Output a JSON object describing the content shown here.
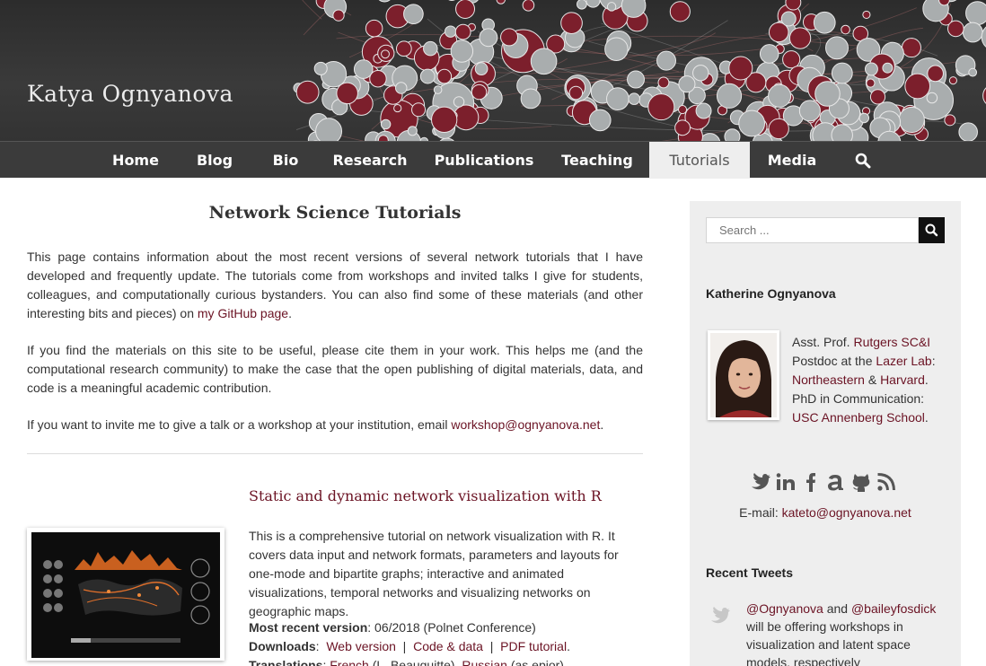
{
  "site": {
    "title": "Katya Ognyanova"
  },
  "nav": {
    "items": [
      {
        "label": "Home",
        "active": false
      },
      {
        "label": "Blog",
        "active": false
      },
      {
        "label": "Bio",
        "active": false
      },
      {
        "label": "Research",
        "active": false
      },
      {
        "label": "Publications",
        "active": false
      },
      {
        "label": "Teaching",
        "active": false
      },
      {
        "label": "Tutorials",
        "active": true
      },
      {
        "label": "Media",
        "active": false
      }
    ],
    "search_icon": "search-icon"
  },
  "main": {
    "title": "Network Science Tutorials",
    "intro1_a": "This page contains information about the most recent versions of several network tutorials that I have developed and frequently update. The tutorials come from workshops and invited talks I give for students, colleagues, and computationally curious bystanders. You can also find some of these materials (and other interesting bits and pieces) on ",
    "intro1_link": "my GitHub page",
    "intro1_b": ".",
    "intro2": "If you find the materials on this site to be useful, please cite them in your work. This helps me (and the computational research community) to make the case that the open publishing of digital materials, data, and code is a meaningful academic contribution.",
    "intro3_a": "If you want to invite me to give a talk or a workshop at your institution, email ",
    "intro3_link": "workshop@ognyanova.net",
    "intro3_b": ".",
    "tutorial": {
      "title": "Static and dynamic network visualization with R",
      "description": "This is a comprehensive tutorial on network visualization with R. It covers data input and network formats, parameters and layouts for one-mode and bipartite graphs; interactive and animated visualizations, temporal networks and visualizing networks on geographic maps.",
      "version_label": "Most recent version",
      "version_value": ": 06/2018 (Polnet Conference)",
      "downloads_label": "Downloads",
      "downloads_sep": ":",
      "download_links": [
        "Web version",
        "Code & data",
        "PDF tutorial"
      ],
      "downloads_end": ".",
      "translations_label": "Translations",
      "translations_sep": ":",
      "translation_1": "French",
      "translation_1_note": " (L. Beauguitte), ",
      "translation_2": "Russian",
      "translation_2_note": " (as.epior)"
    }
  },
  "sidebar": {
    "search_placeholder": "Search ...",
    "profile_name": "Katherine Ognyanova",
    "bio": {
      "l1_a": "Asst. Prof. ",
      "l1_link": "Rutgers SC&I",
      "l2_a": "Postdoc at the ",
      "l2_link": "Lazer Lab",
      "l2_b": ":",
      "l3_link1": "Northeastern",
      "l3_mid": " & ",
      "l3_link2": "Harvard",
      "l3_end": ".",
      "l4": "PhD in Communication:",
      "l5_link": "USC Annenberg School",
      "l5_end": "."
    },
    "social_icons": [
      "twitter-icon",
      "linkedin-icon",
      "facebook-icon",
      "academia-icon",
      "github-icon",
      "rss-icon"
    ],
    "email_label": "E-mail: ",
    "email_link": "kateto@ognyanova.net",
    "tweets_title": "Recent Tweets",
    "tweet": {
      "mention1": "@Ognyanova",
      "and": " and ",
      "mention2": "@baileyfosdick",
      "text": " will be offering workshops in visualization and latent space models, respectively"
    }
  },
  "colors": {
    "link": "#6b1324",
    "nav_bg": "#3b3b3b",
    "sidebar_bg": "#eeeeee",
    "banner_node_red": "#7c1f2c",
    "banner_node_gray": "#a9adae"
  }
}
